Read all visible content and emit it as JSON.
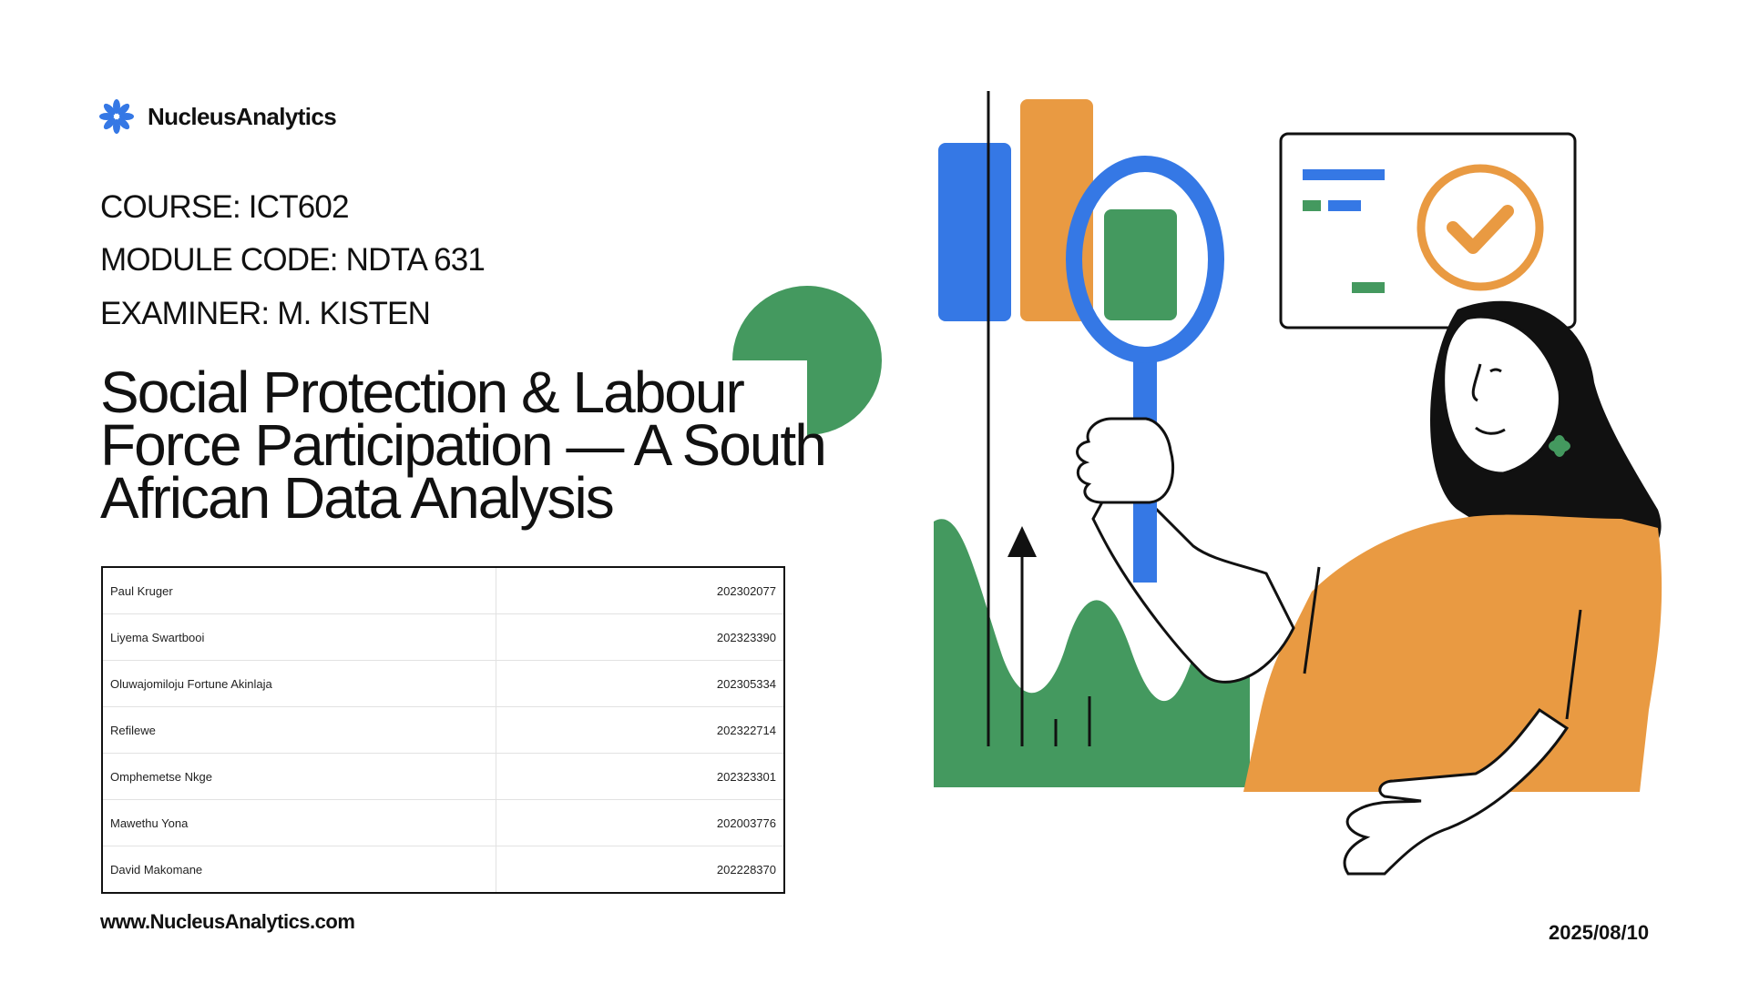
{
  "brand": {
    "name": "NucleusAnalytics",
    "website": "www.NucleusAnalytics.com"
  },
  "info": {
    "course": "COURSE: ICT602",
    "module": "MODULE CODE: NDTA 631",
    "examiner": "EXAMINER: M. KISTEN"
  },
  "title": "Social Protection & Labour Force Participation — A South African Data Analysis",
  "members": [
    {
      "name": "Paul Kruger",
      "number": "202302077"
    },
    {
      "name": "Liyema Swartbooi",
      "number": "202323390"
    },
    {
      "name": "Oluwajomiloju Fortune Akinlaja",
      "number": "202305334"
    },
    {
      "name": "Refilewe",
      "number": "202322714"
    },
    {
      "name": "Omphemetse Nkge",
      "number": "202323301"
    },
    {
      "name": "Mawethu Yona",
      "number": "202003776"
    },
    {
      "name": "David Makomane",
      "number": "202228370"
    }
  ],
  "date": "2025/08/10",
  "colors": {
    "blue": "#3578e5",
    "orange": "#e99a42",
    "green": "#44995f",
    "ink": "#111111"
  },
  "icons": {
    "logo": "asterisk-flower-icon",
    "check": "checkmark-icon"
  }
}
